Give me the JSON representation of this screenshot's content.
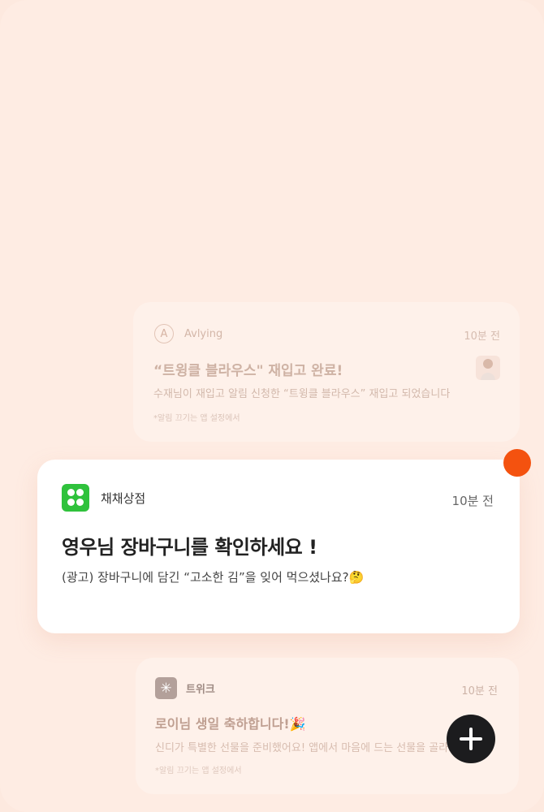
{
  "notifications": [
    {
      "app": "Avlying",
      "time": "10분 전",
      "title": "“트윙클 블라우스\" 재입고 완료!",
      "body": "수재님이 재입고 알림 신청한 “트윙클 블라우스” 재입고 되었습니다",
      "footer": "*알림 끄기는 앱 설정에서",
      "icon": "avlying-logo-icon"
    },
    {
      "app": "채채상점",
      "time": "10분 전",
      "title": "영우님 장바구니를 확인하세요 !",
      "body": "(광고) 장바구니에 담긴 “고소한 김”을 잊어 먹으셨나요?🤔",
      "icon": "chaechae-store-icon",
      "icon_color": "#2fc23c"
    },
    {
      "app": "트위크",
      "time": "10분 전",
      "title": "로이님 생일 축하합니다!🎉",
      "body": "신디가 특별한 선물을 준비했어요! 앱에서 마음에 드는 선물을 골라보세요 🎁",
      "footer": "*알림 끄기는 앱 설정에서",
      "icon": "tweak-asterisk-icon"
    }
  ],
  "badge_color": "#f4520f",
  "fab": {
    "icon": "plus-icon"
  }
}
